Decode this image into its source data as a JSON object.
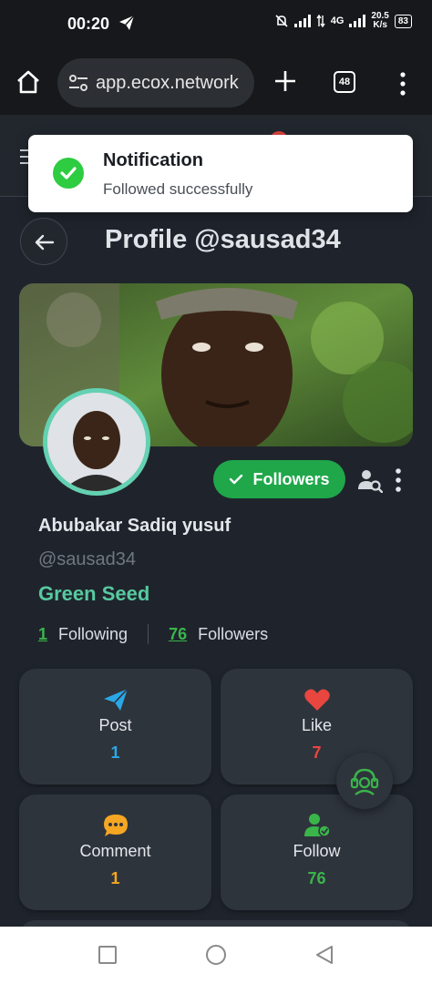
{
  "status_bar": {
    "time": "00:20",
    "network": "4G",
    "speed_value": "20.5",
    "speed_unit": "K/s",
    "battery": "83"
  },
  "browser": {
    "url": "app.ecox.network",
    "tab_count": "48"
  },
  "notification": {
    "title": "Notification",
    "message": "Followed successfully"
  },
  "profile": {
    "title": "Profile @sausad34",
    "display_name": "Abubakar Sadiq yusuf",
    "handle": "@sausad34",
    "rank": "Green Seed",
    "followers_button": "Followers",
    "following_count": "1",
    "following_label": "Following",
    "followers_count": "76",
    "followers_label": "Followers"
  },
  "cards": [
    {
      "label": "Post",
      "value": "1",
      "icon": "paper-plane-icon",
      "color": "#2aa8e6"
    },
    {
      "label": "Like",
      "value": "7",
      "icon": "heart-icon",
      "color": "#e8463f"
    },
    {
      "label": "Comment",
      "value": "1",
      "icon": "comment-icon",
      "color": "#f5a623"
    },
    {
      "label": "Follow",
      "value": "76",
      "icon": "user-check-icon",
      "color": "#3ab54a"
    }
  ],
  "colors": {
    "accent_green": "#1fa74a",
    "rank_teal": "#57c9a0",
    "background": "#1f242c",
    "card": "#2e343c"
  }
}
